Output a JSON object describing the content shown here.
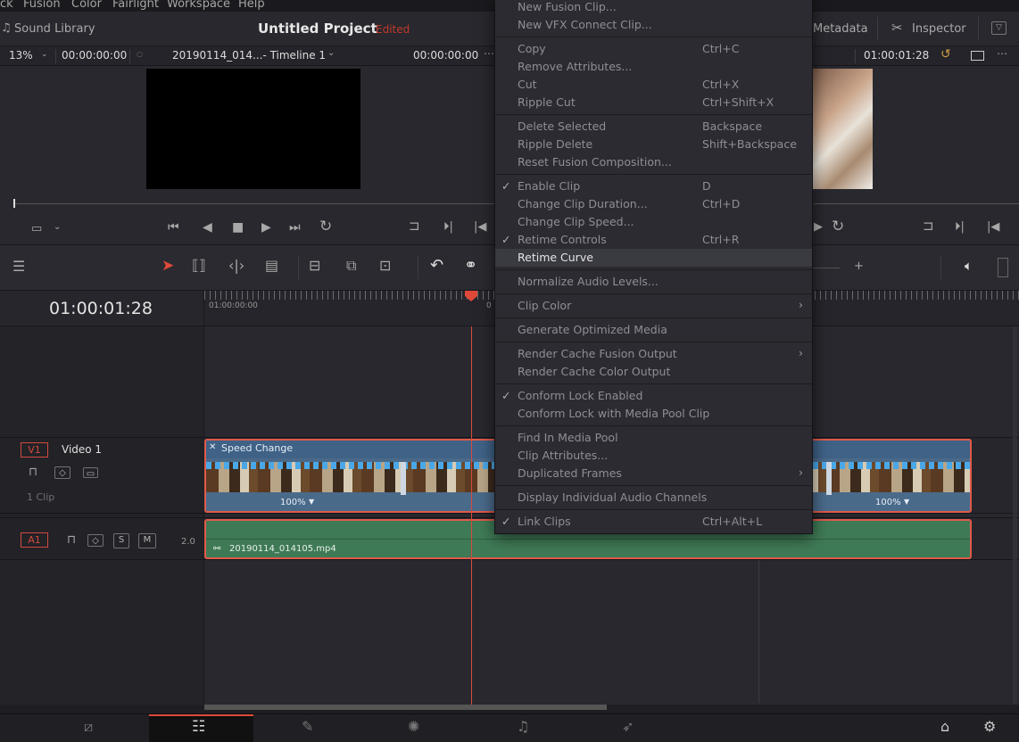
{
  "menu_bar": {
    "items": [
      "ck",
      "Fusion",
      "Color",
      "Fairlight",
      "Workspace",
      "Help"
    ]
  },
  "top_toolbar": {
    "sound_library": "Sound Library",
    "project_title": "Untitled Project",
    "edited_status": "Edited",
    "metadata": "Metadata",
    "inspector": "Inspector"
  },
  "viewer_header": {
    "zoom": "13%",
    "source_timecode": "00:00:00:00",
    "timeline_name": "20190114_014...- Timeline 1",
    "timeline_timecode": "00:00:00:00",
    "record_timecode": "01:00:01:28"
  },
  "timeline": {
    "current_timecode": "01:00:01:28",
    "ruler_start": "01:00:00:00",
    "ruler_partial": "0"
  },
  "tracks": {
    "video": {
      "id": "V1",
      "name": "Video 1",
      "clip_count": "1 Clip",
      "clip_title": "Speed Change",
      "speed_left": "100%",
      "speed_right": "100%"
    },
    "audio": {
      "id": "A1",
      "solo": "S",
      "mute": "M",
      "level": "2.0",
      "clip_name": "20190114_014105.mp4"
    }
  },
  "context_menu": {
    "items": [
      {
        "label": "New Fusion Clip..."
      },
      {
        "label": "New VFX Connect Clip..."
      },
      {
        "label": "Copy",
        "shortcut": "Ctrl+C"
      },
      {
        "label": "Remove Attributes..."
      },
      {
        "label": "Cut",
        "shortcut": "Ctrl+X"
      },
      {
        "label": "Ripple Cut",
        "shortcut": "Ctrl+Shift+X"
      },
      {
        "label": "Delete Selected",
        "shortcut": "Backspace"
      },
      {
        "label": "Ripple Delete",
        "shortcut": "Shift+Backspace"
      },
      {
        "label": "Reset Fusion Composition..."
      },
      {
        "label": "Enable Clip",
        "shortcut": "D",
        "checked": true
      },
      {
        "label": "Change Clip Duration...",
        "shortcut": "Ctrl+D"
      },
      {
        "label": "Change Clip Speed..."
      },
      {
        "label": "Retime Controls",
        "shortcut": "Ctrl+R",
        "checked": true
      },
      {
        "label": "Retime Curve",
        "highlighted": true
      },
      {
        "label": "Normalize Audio Levels..."
      },
      {
        "label": "Clip Color",
        "submenu": true
      },
      {
        "label": "Generate Optimized Media"
      },
      {
        "label": "Render Cache Fusion Output",
        "submenu": true
      },
      {
        "label": "Render Cache Color Output"
      },
      {
        "label": "Conform Lock Enabled",
        "checked": true
      },
      {
        "label": "Conform Lock with Media Pool Clip"
      },
      {
        "label": "Find In Media Pool"
      },
      {
        "label": "Clip Attributes..."
      },
      {
        "label": "Duplicated Frames",
        "submenu": true
      },
      {
        "label": "Display Individual Audio Channels"
      },
      {
        "label": "Link Clips",
        "shortcut": "Ctrl+Alt+L",
        "checked": true
      }
    ]
  },
  "colors": {
    "accent_red": "#e05a4a",
    "video_clip": "#4a6a8a",
    "audio_clip": "#3f7a56",
    "menu_bg": "#2b2b31"
  }
}
